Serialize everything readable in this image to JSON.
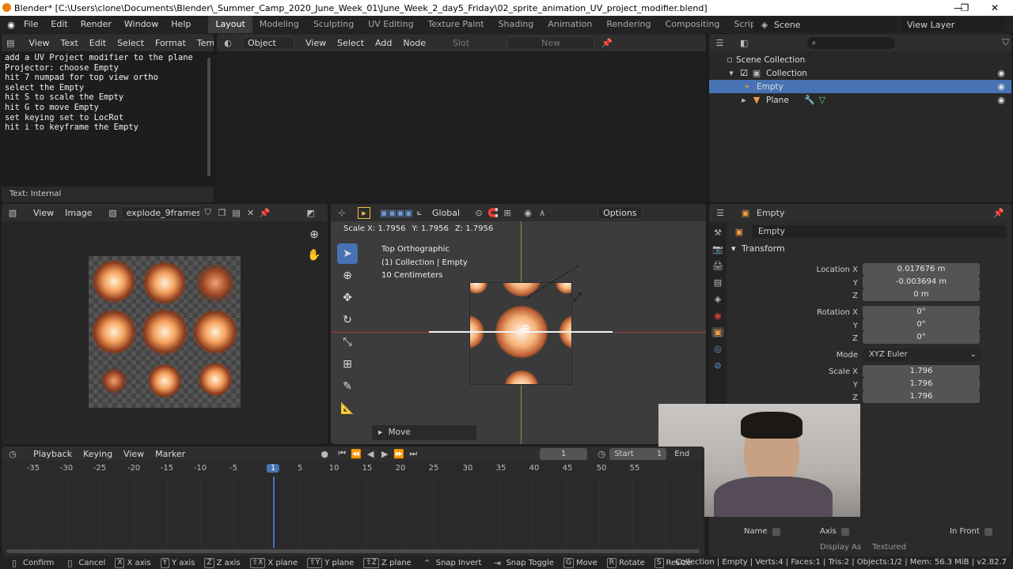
{
  "title_bar": {
    "title": "Blender* [C:\\Users\\clone\\Documents\\Blender\\_Summer_Camp_2020_June_Week_01\\June_Week_2_day5_Friday\\02_sprite_animation_UV_project_modifier.blend]"
  },
  "top_menu": {
    "items": [
      "File",
      "Edit",
      "Render",
      "Window",
      "Help"
    ],
    "workspaces": [
      "Layout",
      "Modeling",
      "Sculpting",
      "UV Editing",
      "Texture Paint",
      "Shading",
      "Animation",
      "Rendering",
      "Compositing",
      "Scripting"
    ],
    "active_workspace": "Layout",
    "scene": "Scene",
    "view_layer": "View Layer"
  },
  "text_editor": {
    "menu": [
      "View",
      "Text",
      "Edit",
      "Select",
      "Format",
      "Templates"
    ],
    "lines": [
      "add a UV Project modifier to the plane",
      "Projector: choose Empty",
      "hit 7 numpad for top view ortho",
      "select the Empty",
      "hit S to scale the Empty",
      "hit G to move Empty",
      "set keying set to LocRot",
      "hit i to keyframe the Empty"
    ],
    "footer": "Text: Internal"
  },
  "node_editor": {
    "mode": "Object",
    "menu": [
      "View",
      "Select",
      "Add",
      "Node"
    ],
    "slot": "Slot",
    "new_label": "New"
  },
  "outliner": {
    "scene_collection": "Scene Collection",
    "collection": "Collection",
    "items": [
      "Empty",
      "Plane"
    ],
    "selected": "Empty"
  },
  "image_editor": {
    "menu": [
      "View",
      "Image"
    ],
    "image_name": "explode_9frames.p..",
    "colors": {
      "fire_core": "#fff1d6",
      "fire_mid": "#f5a15f",
      "fire_edge": "#8a3a1c"
    }
  },
  "viewport": {
    "orientation": "Global",
    "options_label": "Options",
    "scale_readout": {
      "x_label": "Scale X: 1.7956",
      "y_label": "Y: 1.7956",
      "z_label": "Z: 1.7956"
    },
    "overlay": [
      "Top Orthographic",
      "(1) Collection | Empty",
      "10 Centimeters"
    ],
    "move_panel": "Move"
  },
  "properties": {
    "object_name": "Empty",
    "datablock": "Empty",
    "section": "Transform",
    "location": {
      "label_x": "Location X",
      "x": "0.017676 m",
      "y": "-0.003694 m",
      "z": "0 m"
    },
    "rotation": {
      "label_x": "Rotation X",
      "x": "0°",
      "y": "0°",
      "z": "0°"
    },
    "mode_label": "Mode",
    "mode_value": "XYZ Euler",
    "scale": {
      "label_x": "Scale X",
      "x": "1.796",
      "y": "1.796",
      "z": "1.796"
    },
    "axis_labels": {
      "y": "Y",
      "z": "Z"
    },
    "bottom": {
      "name": "Name",
      "axis": "Axis",
      "in_front": "In Front",
      "display_as": "Display As",
      "display_value": "Textured"
    }
  },
  "timeline": {
    "menu": [
      "Playback",
      "Keying",
      "View",
      "Marker"
    ],
    "current_frame": "1",
    "start_label": "Start",
    "start_value": "1",
    "end_label": "End",
    "ticks": [
      "-35",
      "-30",
      "-25",
      "-20",
      "-15",
      "-10",
      "-5",
      "1",
      "5",
      "10",
      "15",
      "20",
      "25",
      "30",
      "35",
      "40",
      "45",
      "50",
      "55"
    ]
  },
  "status_bar": {
    "items": [
      {
        "key": "",
        "label": "Confirm"
      },
      {
        "key": "",
        "label": "Cancel"
      },
      {
        "key": "X",
        "label": "X axis"
      },
      {
        "key": "Y",
        "label": "Y axis"
      },
      {
        "key": "Z",
        "label": "Z axis"
      },
      {
        "key": "⇧X",
        "label": "X plane"
      },
      {
        "key": "⇧Y",
        "label": "Y plane"
      },
      {
        "key": "⇧Z",
        "label": "Z plane"
      },
      {
        "key": "",
        "label": "Snap Invert"
      },
      {
        "key": "",
        "label": "Snap Toggle"
      },
      {
        "key": "G",
        "label": "Move"
      },
      {
        "key": "R",
        "label": "Rotate"
      },
      {
        "key": "S",
        "label": "Resize"
      }
    ],
    "stats": "Collection | Empty | Verts:4 | Faces:1 | Tris:2 | Objects:1/2 | Mem: 56.3 MiB | v2.82.7"
  }
}
